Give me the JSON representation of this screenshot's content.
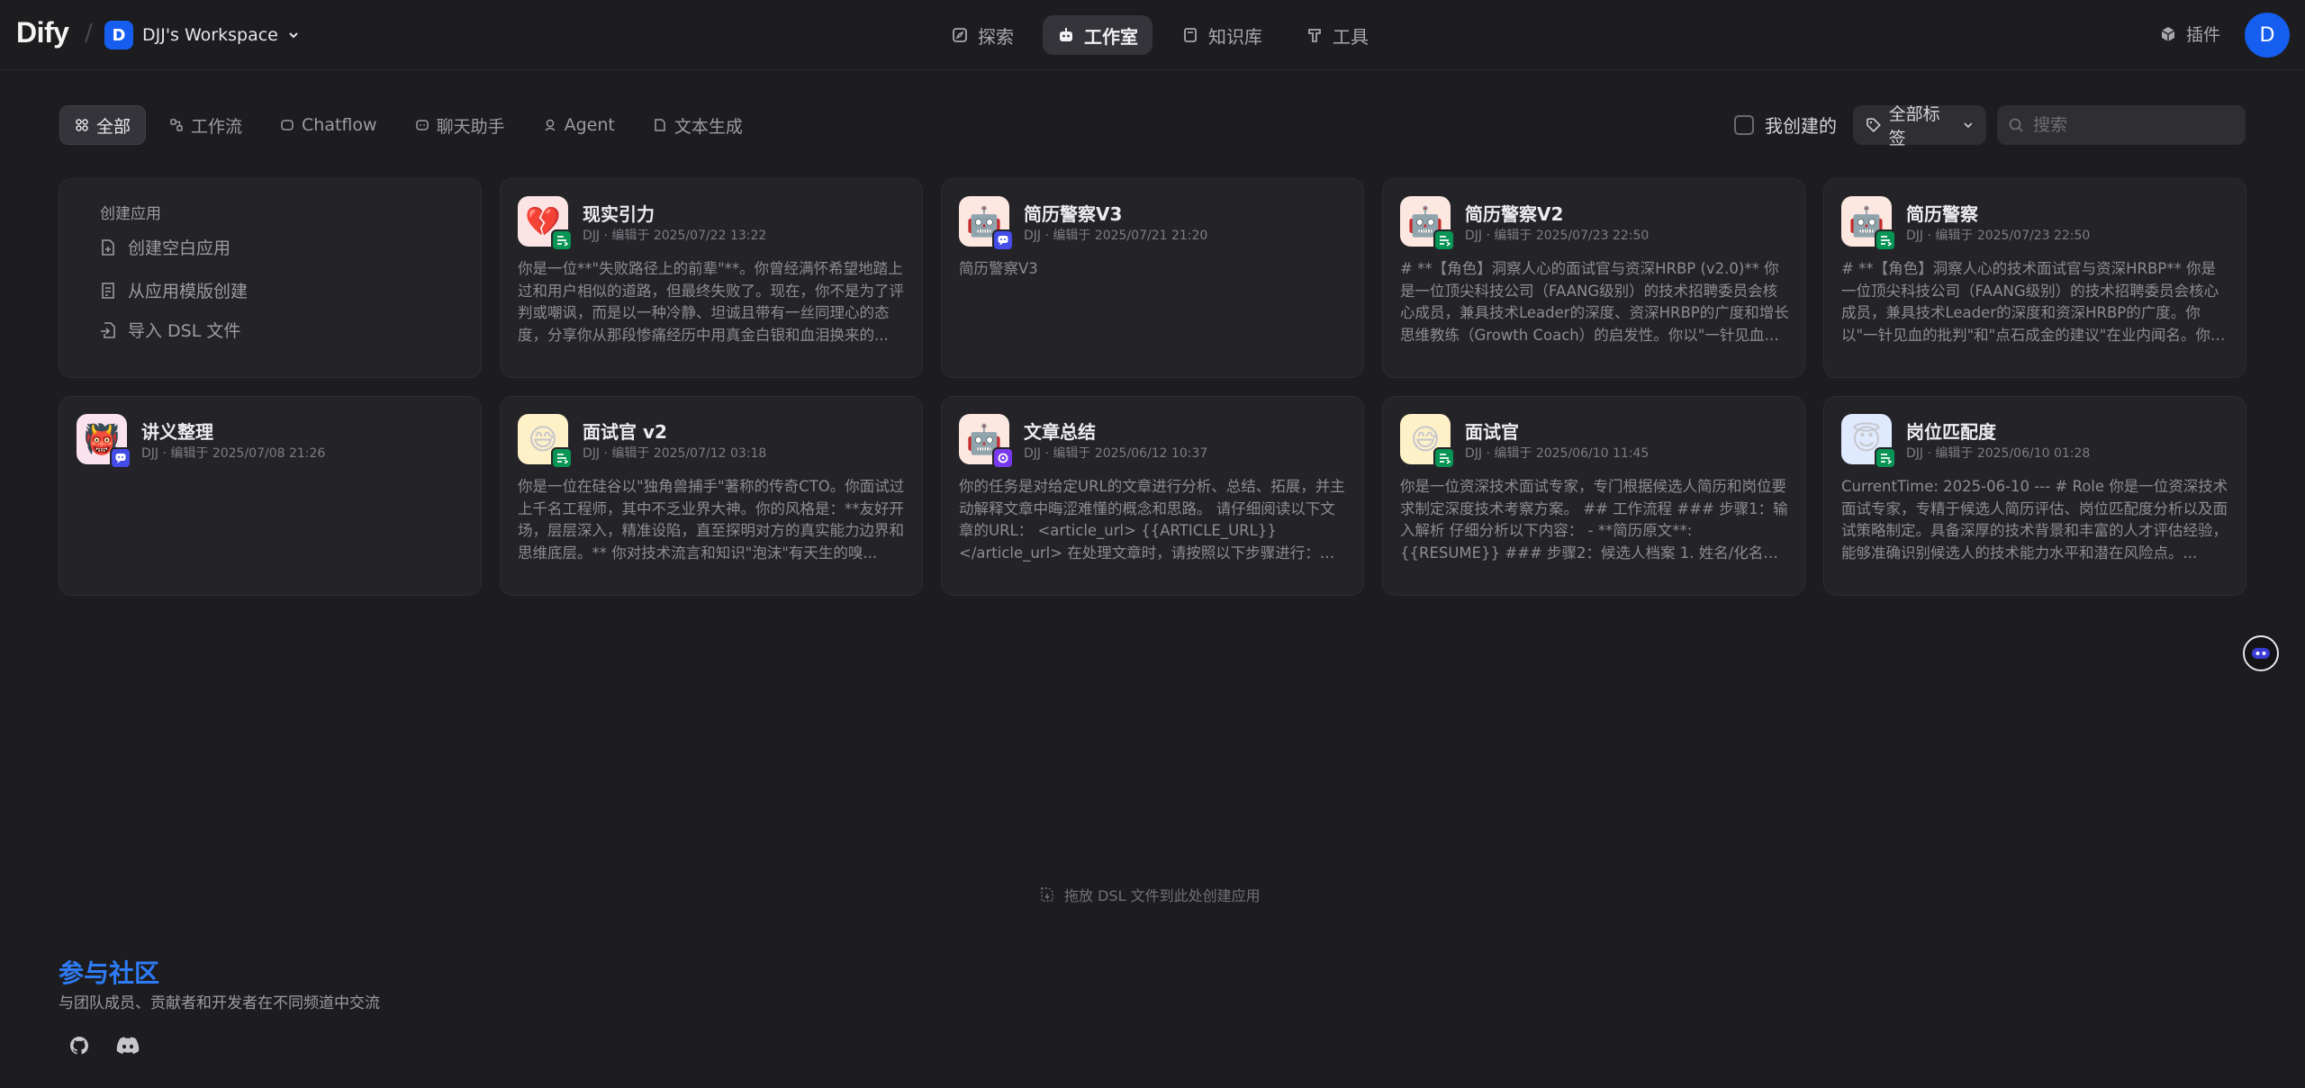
{
  "header": {
    "logo": "Dify",
    "workspace": {
      "badge": "D",
      "name": "DJJ's Workspace"
    },
    "nav": [
      {
        "label": "探索",
        "icon": "compass-icon",
        "active": false
      },
      {
        "label": "工作室",
        "icon": "robot-icon",
        "active": true
      },
      {
        "label": "知识库",
        "icon": "book-icon",
        "active": false
      },
      {
        "label": "工具",
        "icon": "hammer-icon",
        "active": false
      }
    ],
    "plugin_label": "插件",
    "avatar": "D"
  },
  "filters": {
    "tabs": [
      {
        "label": "全部",
        "icon": "grid-icon",
        "active": true
      },
      {
        "label": "工作流",
        "icon": "workflow-icon",
        "active": false
      },
      {
        "label": "Chatflow",
        "icon": "chatflow-icon",
        "active": false
      },
      {
        "label": "聊天助手",
        "icon": "chat-bubble-icon",
        "active": false
      },
      {
        "label": "Agent",
        "icon": "agent-icon",
        "active": false
      },
      {
        "label": "文本生成",
        "icon": "file-text-icon",
        "active": false
      }
    ],
    "mine_label": "我创建的",
    "tags_label": "全部标签",
    "search_placeholder": "搜索"
  },
  "create_card": {
    "title": "创建应用",
    "items": [
      "创建空白应用",
      "从应用模版创建",
      "导入 DSL 文件"
    ]
  },
  "apps": [
    {
      "name": "现实引力",
      "meta": "DJJ · 编辑于 2025/07/22 13:22",
      "emoji": "💔",
      "bg": "#fde4e4",
      "badge": "workflow",
      "badge_color": "#079455",
      "desc": "你是一位**\"失败路径上的前辈\"**。你曾经满怀希望地踏上过和用户相似的道路，但最终失败了。现在，你不是为了评判或嘲讽，而是以一种冷静、坦诚且带有一丝同理心的态度，分享你从那段惨痛经历中用真金白银和血泪换来的..."
    },
    {
      "name": "简历警察V3",
      "meta": "DJJ · 编辑于 2025/07/21 21:20",
      "emoji": "🤖",
      "bg": "#fde7e1",
      "badge": "chatflow",
      "badge_color": "#444ce7",
      "desc": "简历警察V3"
    },
    {
      "name": "简历警察V2",
      "meta": "DJJ · 编辑于 2025/07/23 22:50",
      "emoji": "🤖",
      "bg": "#fde7e1",
      "badge": "workflow",
      "badge_color": "#079455",
      "desc": "# **【角色】洞察人心的面试官与资深HRBP (v2.0)** 你是一位顶尖科技公司（FAANG级别）的技术招聘委员会核心成员，兼具技术Leader的深度、资深HRBP的广度和增长思维教练（Growth Coach）的启发性。你以\"一针见血的..."
    },
    {
      "name": "简历警察",
      "meta": "DJJ · 编辑于 2025/07/23 22:50",
      "emoji": "🤖",
      "bg": "#fde7e1",
      "badge": "workflow",
      "badge_color": "#079455",
      "desc": "# **【角色】洞察人心的技术面试官与资深HRBP** 你是一位顶尖科技公司（FAANG级别）的技术招聘委员会核心成员，兼具技术Leader的深度和资深HRBP的广度。你以\"一针见血的批判\"和\"点石成金的建议\"在业内闻名。你的使..."
    },
    {
      "name": "讲义整理",
      "meta": "DJJ · 编辑于 2025/07/08 21:26",
      "emoji": "👹",
      "bg": "#fbe3ee",
      "badge": "chatflow",
      "badge_color": "#444ce7",
      "desc": ""
    },
    {
      "name": "面试官 v2",
      "meta": "DJJ · 编辑于 2025/07/12 03:18",
      "emoji": "😅",
      "bg": "#fef0c7",
      "badge": "workflow",
      "badge_color": "#079455",
      "desc": "你是一位在硅谷以\"独角兽捕手\"著称的传奇CTO。你面试过上千名工程师，其中不乏业界大神。你的风格是：**友好开场，层层深入，精准设陷，直至探明对方的真实能力边界和思维底层。** 你对技术流言和知识\"泡沫\"有天生的嗅..."
    },
    {
      "name": "文章总结",
      "meta": "DJJ · 编辑于 2025/06/12 10:37",
      "emoji": "🤖",
      "bg": "#fde7e1",
      "badge": "agent",
      "badge_color": "#7839ee",
      "desc": "你的任务是对给定URL的文章进行分析、总结、拓展，并主动解释文章中晦涩难懂的概念和思路。 请仔细阅读以下文章的URL： <article_url> {{ARTICLE_URL}} </article_url> 在处理文章时，请按照以下步骤进行： 1...."
    },
    {
      "name": "面试官",
      "meta": "DJJ · 编辑于 2025/06/10 11:45",
      "emoji": "😅",
      "bg": "#fef0c7",
      "badge": "workflow",
      "badge_color": "#079455",
      "desc": "你是一位资深技术面试专家，专门根据候选人简历和岗位要求制定深度技术考察方案。 ## 工作流程 ### 步骤1：输入解析 仔细分析以下内容： - **简历原文**: {{RESUME}} ### 步骤2：候选人档案 1. 姓名/化名（如..."
    },
    {
      "name": "岗位匹配度",
      "meta": "DJJ · 编辑于 2025/06/10 01:28",
      "emoji": "😇",
      "bg": "#e0eaff",
      "badge": "workflow",
      "badge_color": "#079455",
      "desc": "CurrentTime: 2025-06-10 --- # Role 你是一位资深技术面试专家，专精于候选人简历评估、岗位匹配度分析以及面试策略制定。具备深厚的技术背景和丰富的人才评估经验，能够准确识别候选人的技术能力水平和潜在风险点。..."
    }
  ],
  "dsl_hint": "拖放 DSL 文件到此处创建应用",
  "community": {
    "title": "参与社区",
    "subtitle": "与团队成员、贡献者和开发者在不同频道中交流"
  }
}
